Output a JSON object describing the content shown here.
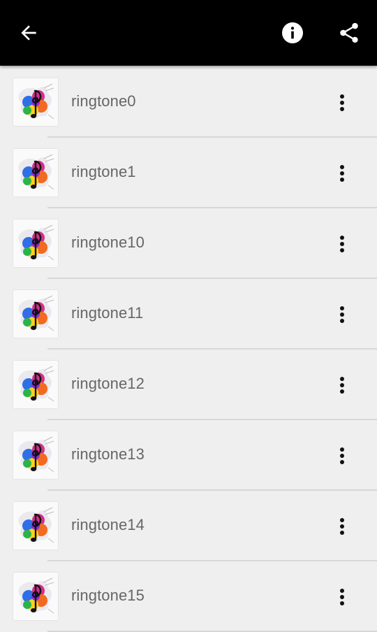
{
  "appbar": {
    "back_icon": "arrow-left-icon",
    "info_icon": "info-icon",
    "share_icon": "share-icon"
  },
  "list": {
    "item_icon": "music-note-paint-splash-icon",
    "menu_icon": "more-vert-icon",
    "items": [
      {
        "label": "ringtone0"
      },
      {
        "label": "ringtone1"
      },
      {
        "label": "ringtone10"
      },
      {
        "label": "ringtone11"
      },
      {
        "label": "ringtone12"
      },
      {
        "label": "ringtone13"
      },
      {
        "label": "ringtone14"
      },
      {
        "label": "ringtone15"
      }
    ]
  },
  "colors": {
    "appbar": "#000000",
    "background": "#efefef",
    "label": "#666666"
  }
}
